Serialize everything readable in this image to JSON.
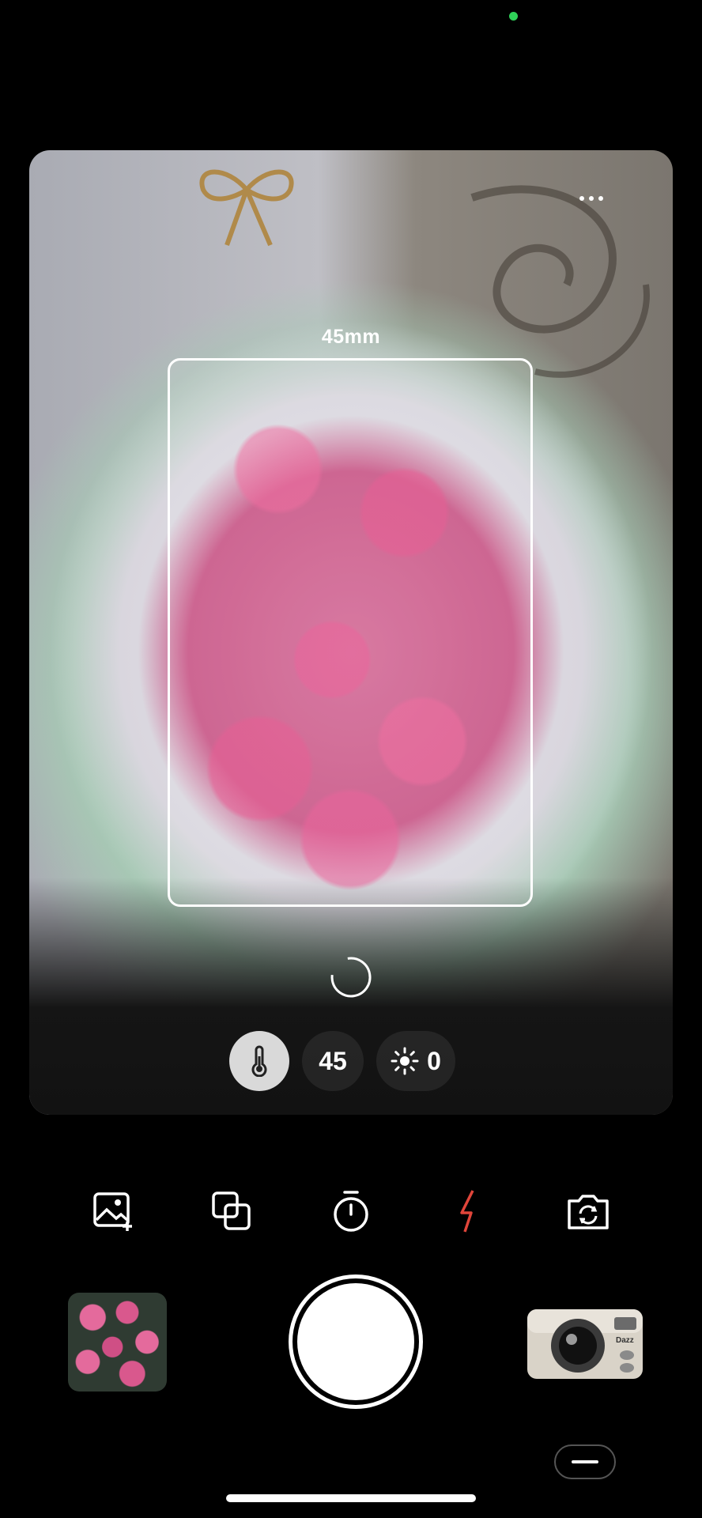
{
  "viewfinder": {
    "focal_label": "45mm",
    "more_icon": "more-horizontal-icon",
    "focus_icon": "focus-loading-icon"
  },
  "pills": {
    "temperature_icon": "thermometer-icon",
    "focal_value": "45",
    "exposure_icon": "sun-brightness-icon",
    "exposure_value": "0"
  },
  "toolbar": {
    "icons": [
      "add-photo-icon",
      "layers-icon",
      "timer-icon",
      "flash-icon",
      "switch-camera-icon"
    ],
    "flash_color": "#e0453a"
  },
  "colors": {
    "accent_status": "#2fd158",
    "background": "#000000"
  },
  "camera_model": {
    "brand": "Dazz"
  }
}
